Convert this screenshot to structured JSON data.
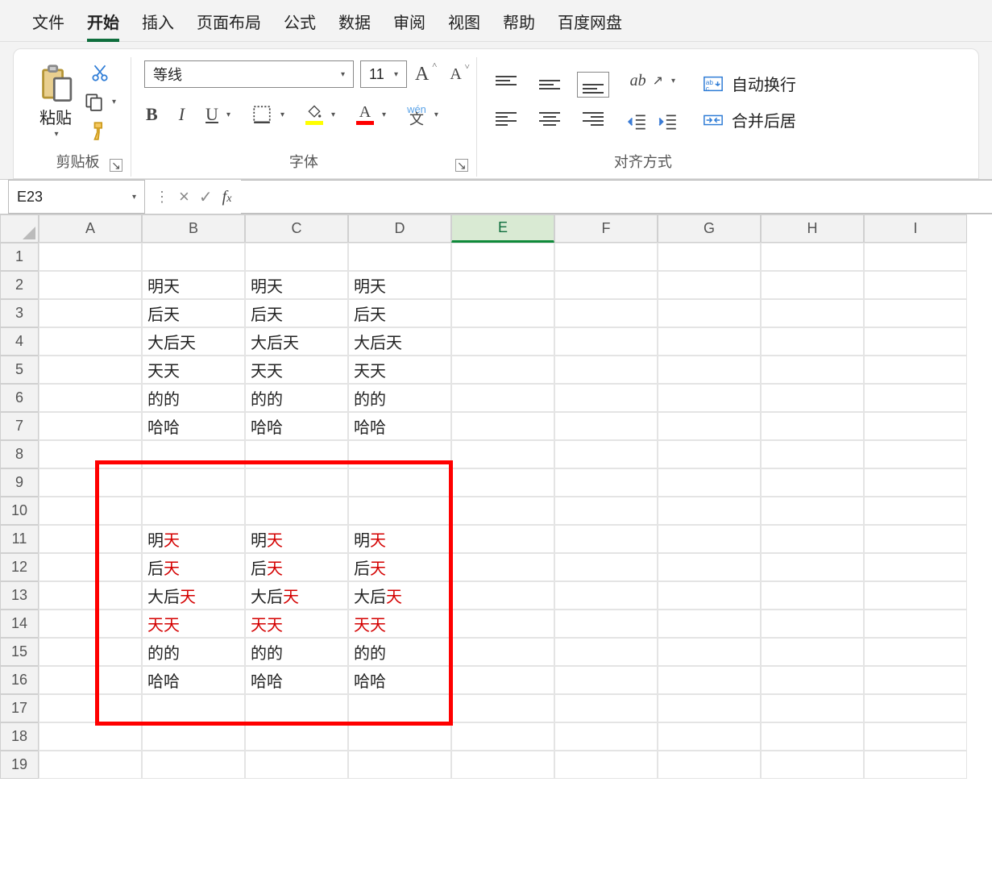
{
  "menu": {
    "tabs": [
      "文件",
      "开始",
      "插入",
      "页面布局",
      "公式",
      "数据",
      "审阅",
      "视图",
      "帮助",
      "百度网盘"
    ],
    "active_index": 1
  },
  "ribbon": {
    "clipboard": {
      "paste": "粘贴",
      "group_label": "剪贴板"
    },
    "font": {
      "family": "等线",
      "size": "11",
      "group_label": "字体",
      "bold": "B",
      "italic": "I",
      "underline": "U",
      "increase_name": "increase-font-icon",
      "decrease_name": "decrease-font-icon"
    },
    "alignment": {
      "group_label": "对齐方式",
      "wrap_text": "自动换行",
      "merge_center": "合并后居"
    }
  },
  "namebox": {
    "ref": "E23"
  },
  "columns": [
    "A",
    "B",
    "C",
    "D",
    "E",
    "F",
    "G",
    "H",
    "I"
  ],
  "selected_col_index": 4,
  "rows_shown": 19,
  "selected_cell": {
    "row": 23,
    "col": "E"
  },
  "cells_plain": {
    "B2": "明天",
    "C2": "明天",
    "D2": "明天",
    "B3": "后天",
    "C3": "后天",
    "D3": "后天",
    "B4": "大后天",
    "C4": "大后天",
    "D4": "大后天",
    "B5": "天天",
    "C5": "天天",
    "D5": "天天",
    "B6": "的的",
    "C6": "的的",
    "D6": "的的",
    "B7": "哈哈",
    "C7": "哈哈",
    "D7": "哈哈"
  },
  "cells_rich": {
    "B11": [
      {
        "t": "明"
      },
      {
        "t": "天",
        "c": "red"
      }
    ],
    "C11": [
      {
        "t": "明"
      },
      {
        "t": "天",
        "c": "red"
      }
    ],
    "D11": [
      {
        "t": "明"
      },
      {
        "t": "天",
        "c": "red"
      }
    ],
    "B12": [
      {
        "t": "后"
      },
      {
        "t": "天",
        "c": "red"
      }
    ],
    "C12": [
      {
        "t": "后"
      },
      {
        "t": "天",
        "c": "red"
      }
    ],
    "D12": [
      {
        "t": "后"
      },
      {
        "t": "天",
        "c": "red"
      }
    ],
    "B13": [
      {
        "t": "大后"
      },
      {
        "t": "天",
        "c": "red"
      }
    ],
    "C13": [
      {
        "t": "大后"
      },
      {
        "t": "天",
        "c": "red"
      }
    ],
    "D13": [
      {
        "t": "大后"
      },
      {
        "t": "天",
        "c": "red"
      }
    ],
    "B14": [
      {
        "t": "天天",
        "c": "red"
      }
    ],
    "C14": [
      {
        "t": "天天",
        "c": "red"
      }
    ],
    "D14": [
      {
        "t": "天天",
        "c": "red"
      }
    ],
    "B15": [
      {
        "t": "的的"
      }
    ],
    "C15": [
      {
        "t": "的的"
      }
    ],
    "D15": [
      {
        "t": "的的"
      }
    ],
    "B16": [
      {
        "t": "哈哈"
      }
    ],
    "C16": [
      {
        "t": "哈哈"
      }
    ],
    "D16": [
      {
        "t": "哈哈"
      }
    ]
  },
  "annotation_box": {
    "top_row": 9,
    "bottom_row": 17,
    "left_col": "A_mid",
    "right_col": "D_end"
  }
}
